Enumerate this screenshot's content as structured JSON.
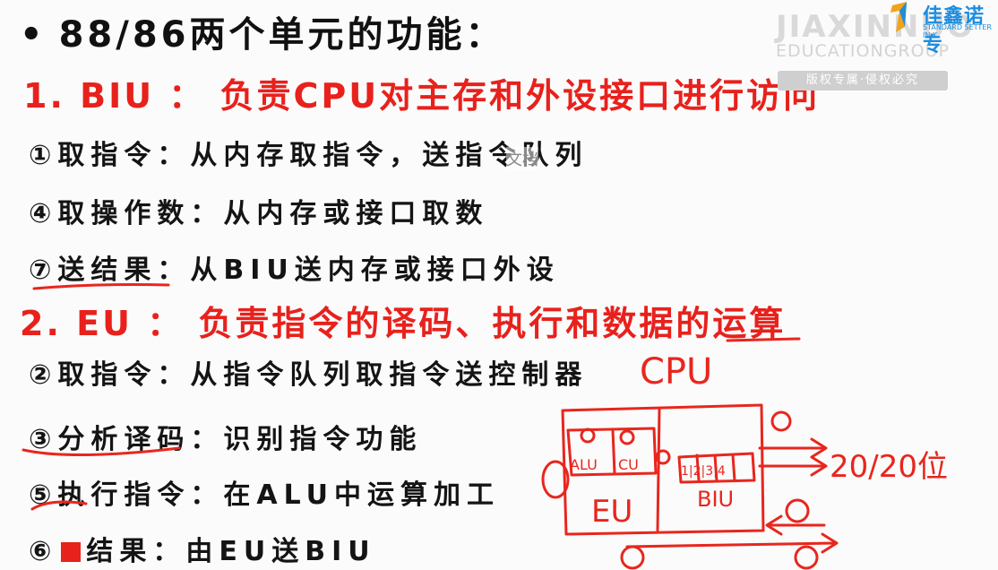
{
  "title": {
    "bullet": "•",
    "text": "88/86两个单元的功能："
  },
  "biu": {
    "heading": "1. BIU ： 负责CPU对主存和外设接口进行访问"
  },
  "biu_items": [
    {
      "num": "①",
      "text": "取指令：从内存取指令，送指令队列"
    },
    {
      "num": "④",
      "text": "取操作数：从内存或接口取数"
    },
    {
      "num": "⑦",
      "text": "送结果：从BIU送内存或接口外设"
    }
  ],
  "eu": {
    "heading": "2. EU ： 负责指令的译码、执行和数据的运算"
  },
  "eu_items": [
    {
      "num": "②",
      "text": "取指令：从指令队列取指令送控制器"
    },
    {
      "num": "③",
      "text": "分析译码：识别指令功能"
    },
    {
      "num": "⑤",
      "text": "执行指令：在ALU中运算加工"
    },
    {
      "num": "⑥",
      "text": "结果：由EU送BIU"
    }
  ],
  "watermark": {
    "main": "JIAXINNUO",
    "sub": "EDUCATIONGROUP",
    "badge": "版权专属·侵权必究",
    "logo_text": "佳鑫诺专",
    "logo_tag": "STANDARD SETTER IN K"
  },
  "popup": "文档",
  "annotations": {
    "cpu": "CPU",
    "eu_box": "EU",
    "biu_box": "BIU",
    "alu_box": "ALU",
    "cu_box": "CU",
    "queue": "1|2|3|4",
    "addr": "20/20位"
  },
  "colors": {
    "accent_red": "#e8211c",
    "text": "#141414",
    "brand_blue": "#1c8ee0"
  }
}
